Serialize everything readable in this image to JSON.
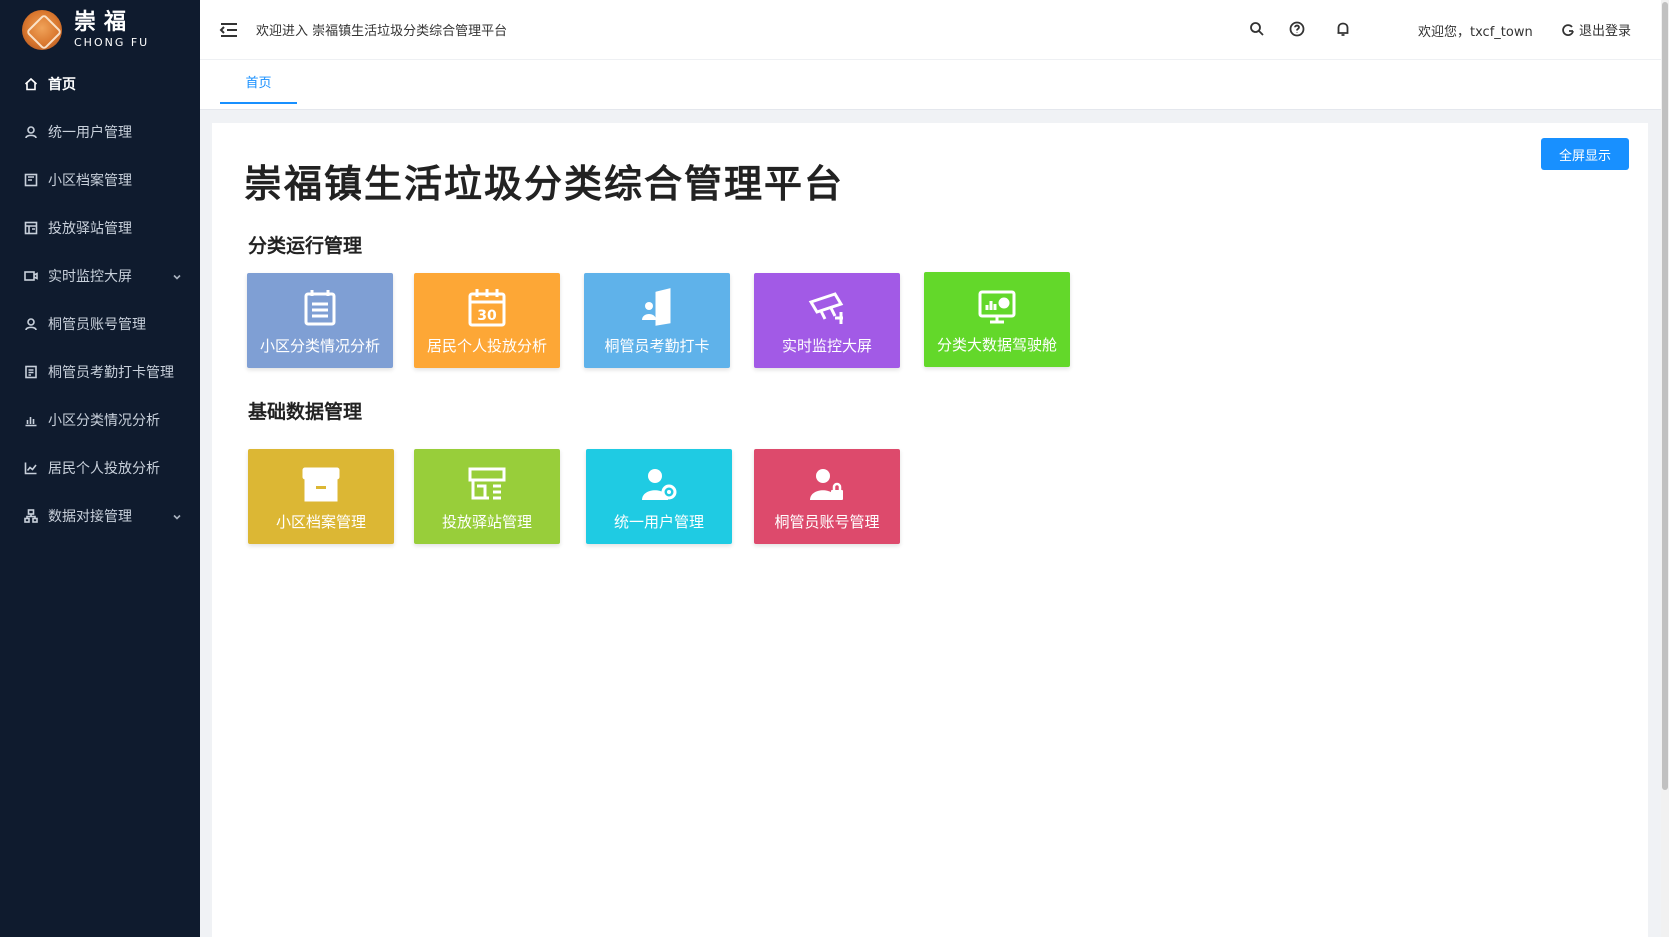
{
  "brand": {
    "cn": "崇福",
    "en": "CHONG FU"
  },
  "sidebar": {
    "items": [
      {
        "label": "首页",
        "icon": "home-icon",
        "active": true
      },
      {
        "label": "统一用户管理",
        "icon": "user-icon"
      },
      {
        "label": "小区档案管理",
        "icon": "archive-icon"
      },
      {
        "label": "投放驿站管理",
        "icon": "station-icon"
      },
      {
        "label": "实时监控大屏",
        "icon": "camera-icon",
        "expandable": true
      },
      {
        "label": "桐管员账号管理",
        "icon": "user-icon"
      },
      {
        "label": "桐管员考勤打卡管理",
        "icon": "clipboard-icon"
      },
      {
        "label": "小区分类情况分析",
        "icon": "bar-chart-icon"
      },
      {
        "label": "居民个人投放分析",
        "icon": "line-chart-icon"
      },
      {
        "label": "数据对接管理",
        "icon": "network-icon",
        "expandable": true
      }
    ]
  },
  "header": {
    "welcome": "欢迎进入 崇福镇生活垃圾分类综合管理平台",
    "user": "欢迎您，txcf_town",
    "logout": "退出登录"
  },
  "tabs": [
    {
      "label": "首页",
      "active": true
    }
  ],
  "main": {
    "title": "崇福镇生活垃圾分类综合管理平台",
    "fullscreen_button": "全屏显示",
    "sections": [
      {
        "title": "分类运行管理",
        "tiles": [
          {
            "label": "小区分类情况分析",
            "color": "#7f9fd4",
            "icon": "calendar-list-icon"
          },
          {
            "label": "居民个人投放分析",
            "color": "#fda736",
            "icon": "calendar-30-icon"
          },
          {
            "label": "桐管员考勤打卡",
            "color": "#5fb2ea",
            "icon": "door-user-icon"
          },
          {
            "label": "实时监控大屏",
            "color": "#a25ae6",
            "icon": "cctv-icon"
          },
          {
            "label": "分类大数据驾驶舱",
            "color": "#63d82a",
            "icon": "monitor-chart-icon"
          }
        ]
      },
      {
        "title": "基础数据管理",
        "tiles": [
          {
            "label": "小区档案管理",
            "color": "#dcb734",
            "icon": "archive-box-icon"
          },
          {
            "label": "投放驿站管理",
            "color": "#98ce3a",
            "icon": "shop-icon"
          },
          {
            "label": "统一用户管理",
            "color": "#1fcbe3",
            "icon": "user-gear-icon"
          },
          {
            "label": "桐管员账号管理",
            "color": "#dd4a6c",
            "icon": "user-lock-icon"
          }
        ]
      }
    ]
  }
}
